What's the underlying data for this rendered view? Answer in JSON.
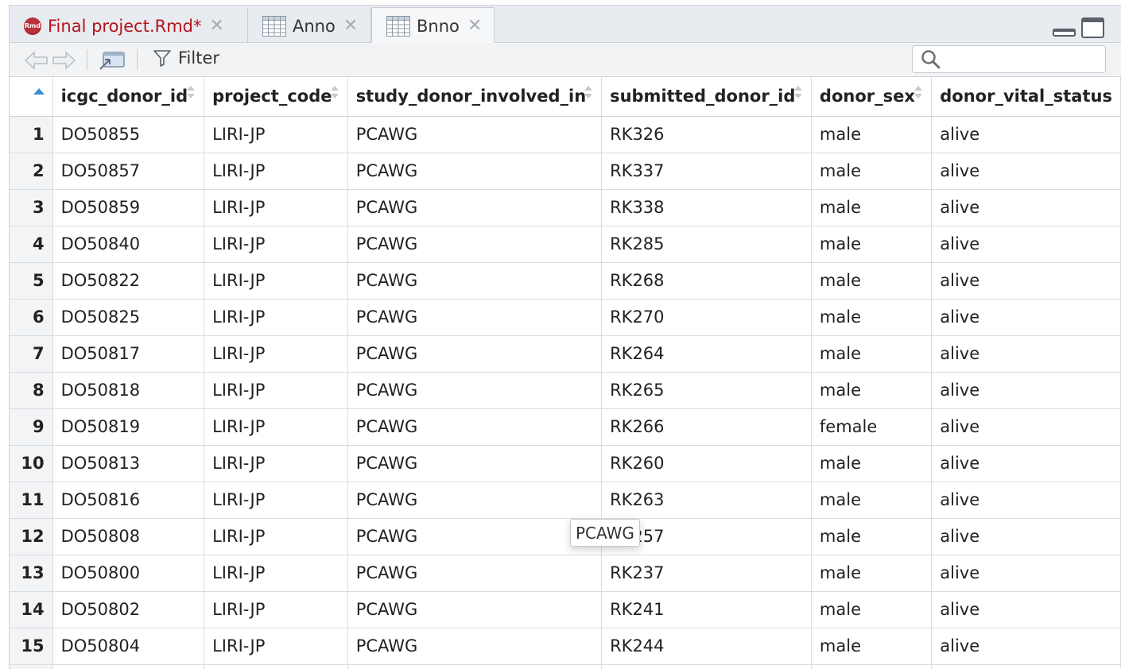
{
  "tabs": [
    {
      "label": "Final project.Rmd*",
      "icon": "rmarkdown-icon",
      "icon_text": "Rmd",
      "modified": true,
      "active": false
    },
    {
      "label": "Anno",
      "icon": "data-grid-icon",
      "active": false
    },
    {
      "label": "Bnno",
      "icon": "data-grid-icon",
      "active": true
    }
  ],
  "toolbar": {
    "filter_label": "Filter",
    "search_placeholder": ""
  },
  "table": {
    "columns": [
      "icgc_donor_id",
      "project_code",
      "study_donor_involved_in",
      "submitted_donor_id",
      "donor_sex",
      "donor_vital_status"
    ],
    "rows": [
      [
        "1",
        "DO50855",
        "LIRI-JP",
        "PCAWG",
        "RK326",
        "male",
        "alive"
      ],
      [
        "2",
        "DO50857",
        "LIRI-JP",
        "PCAWG",
        "RK337",
        "male",
        "alive"
      ],
      [
        "3",
        "DO50859",
        "LIRI-JP",
        "PCAWG",
        "RK338",
        "male",
        "alive"
      ],
      [
        "4",
        "DO50840",
        "LIRI-JP",
        "PCAWG",
        "RK285",
        "male",
        "alive"
      ],
      [
        "5",
        "DO50822",
        "LIRI-JP",
        "PCAWG",
        "RK268",
        "male",
        "alive"
      ],
      [
        "6",
        "DO50825",
        "LIRI-JP",
        "PCAWG",
        "RK270",
        "male",
        "alive"
      ],
      [
        "7",
        "DO50817",
        "LIRI-JP",
        "PCAWG",
        "RK264",
        "male",
        "alive"
      ],
      [
        "8",
        "DO50818",
        "LIRI-JP",
        "PCAWG",
        "RK265",
        "male",
        "alive"
      ],
      [
        "9",
        "DO50819",
        "LIRI-JP",
        "PCAWG",
        "RK266",
        "female",
        "alive"
      ],
      [
        "10",
        "DO50813",
        "LIRI-JP",
        "PCAWG",
        "RK260",
        "male",
        "alive"
      ],
      [
        "11",
        "DO50816",
        "LIRI-JP",
        "PCAWG",
        "RK263",
        "male",
        "alive"
      ],
      [
        "12",
        "DO50808",
        "LIRI-JP",
        "PCAWG",
        "RK257",
        "male",
        "alive"
      ],
      [
        "13",
        "DO50800",
        "LIRI-JP",
        "PCAWG",
        "RK237",
        "male",
        "alive"
      ],
      [
        "14",
        "DO50802",
        "LIRI-JP",
        "PCAWG",
        "RK241",
        "male",
        "alive"
      ],
      [
        "15",
        "DO50804",
        "LIRI-JP",
        "PCAWG",
        "RK244",
        "male",
        "alive"
      ],
      [
        "",
        "",
        "",
        "",
        "",
        "",
        ""
      ]
    ]
  },
  "tooltip": {
    "text": "PCAWG"
  },
  "colors": {
    "modified_tab": "#b5121b",
    "sort_arrow_active": "#3b8fd6"
  }
}
